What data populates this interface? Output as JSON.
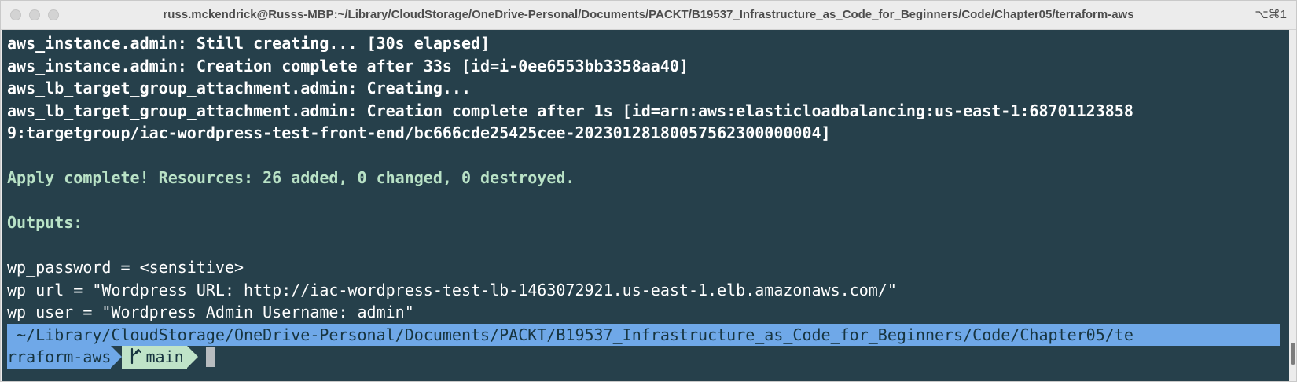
{
  "window": {
    "title": "russ.mckendrick@Russs-MBP:~/Library/CloudStorage/OneDrive-Personal/Documents/PACKT/B19537_Infrastructure_as_Code_for_Beginners/Code/Chapter05/terraform-aws",
    "shortcut": "⌥⌘1"
  },
  "terminal": {
    "lines": [
      "aws_instance.admin: Still creating... [30s elapsed]",
      "aws_instance.admin: Creation complete after 33s [id=i-0ee6553bb3358aa40]",
      "aws_lb_target_group_attachment.admin: Creating...",
      "aws_lb_target_group_attachment.admin: Creation complete after 1s [id=arn:aws:elasticloadbalancing:us-east-1:68701123858",
      "9:targetgroup/iac-wordpress-test-front-end/bc666cde25425cee-20230128180057562300000004]"
    ],
    "apply_summary": "Apply complete! Resources: 26 added, 0 changed, 0 destroyed.",
    "outputs_label": "Outputs:",
    "outputs": [
      "wp_password = <sensitive>",
      "wp_url = \"Wordpress URL: http://iac-wordpress-test-lb-1463072921.us-east-1.elb.amazonaws.com/\"",
      "wp_user = \"Wordpress Admin Username: admin\""
    ],
    "prompt": {
      "path_line1": " ~/Library/CloudStorage/OneDrive-Personal/Documents/PACKT/B19537_Infrastructure_as_Code_for_Beginners/Code/Chapter05/te",
      "path_line2": "rraform-aws ",
      "branch_icon": "git-branch-icon",
      "branch": "main"
    }
  },
  "colors": {
    "terminal_bg": "#26404b",
    "success_text": "#b9e2c6",
    "prompt_path_bg": "#6fa8e8",
    "prompt_branch_bg": "#bfe3c8"
  }
}
